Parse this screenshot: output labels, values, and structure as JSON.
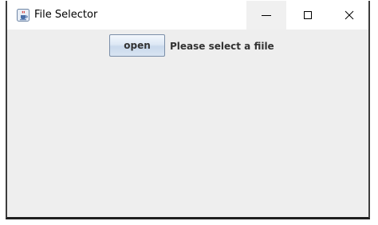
{
  "window": {
    "title": "File Selector",
    "icon": "java-coffee-cup-icon",
    "controls": {
      "minimize_icon": "minimize-icon",
      "maximize_icon": "maximize-icon",
      "close_icon": "close-icon"
    }
  },
  "main": {
    "open_button_label": "open",
    "status_text": "Please select a fiile"
  },
  "colors": {
    "titlebar": "#ffffff",
    "content_background": "#eeeeee",
    "button_border": "#7a8ea8",
    "text": "#333333"
  }
}
